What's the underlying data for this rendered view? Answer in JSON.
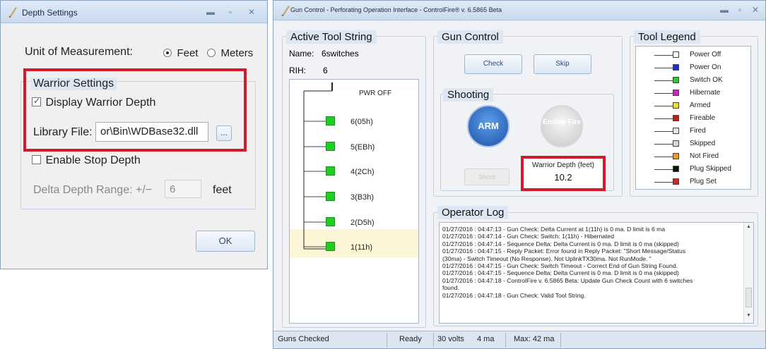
{
  "depth_settings": {
    "title": "Depth Settings",
    "unit_label": "Unit of Measurement:",
    "unit_options": [
      "Feet",
      "Meters"
    ],
    "unit_selected": "Feet",
    "warrior_group_title": "Warrior Settings",
    "display_warrior_depth_label": "Display Warrior Depth",
    "display_warrior_depth_checked": true,
    "library_file_label": "Library File:",
    "library_file_value": "or\\Bin\\WDBase32.dll",
    "browse_label": "...",
    "enable_stop_depth_label": "Enable Stop Depth",
    "enable_stop_depth_checked": false,
    "delta_depth_label": "Delta Depth Range: +/−",
    "delta_depth_value": "6",
    "delta_depth_unit": "feet",
    "ok_label": "OK",
    "highlight_color": "#d3192a"
  },
  "gun_control": {
    "title": "Gun Control - Perforating Operation Interface - ControlFire® v. 6.5865 Beta",
    "active_tool_string": {
      "title": "Active Tool String",
      "name_label": "Name:",
      "name_value": "6switches",
      "rih_label": "RIH:",
      "rih_value": "6",
      "pwr_label": "PWR OFF",
      "switches": [
        "6(05h)",
        "5(EBh)",
        "4(2Ch)",
        "3(B3h)",
        "2(D5h)",
        "1(11h)"
      ],
      "selected_switch": "1(11h)"
    },
    "gun_control_panel": {
      "title": "Gun Control",
      "check_label": "Check",
      "skip_label": "Skip",
      "shooting_title": "Shooting",
      "arm_label": "ARM",
      "enable_fire_label": "Enable Fire",
      "shoot_label": "Shoot",
      "warrior_depth_label": "Warrior Depth (feet)",
      "warrior_depth_value": "10.2"
    },
    "tool_legend": {
      "title": "Tool Legend",
      "items": [
        {
          "label": "Power Off",
          "color": "#ffffff"
        },
        {
          "label": "Power On",
          "color": "#1a2ee0"
        },
        {
          "label": "Switch OK",
          "color": "#22d022"
        },
        {
          "label": "Hibernate",
          "color": "#d020d0"
        },
        {
          "label": "Armed",
          "color": "#f0e020"
        },
        {
          "label": "Fireable",
          "color": "#d01818"
        },
        {
          "label": "Fired",
          "color": "#e8e8e8"
        },
        {
          "label": "Skipped",
          "color": "#d8d8d8"
        },
        {
          "label": "Not Fired",
          "color": "#f09a20"
        },
        {
          "label": "Plug Skipped",
          "color": "#111111"
        },
        {
          "label": "Plug Set",
          "color": "#e02020"
        }
      ]
    },
    "operator_log": {
      "title": "Operator Log",
      "lines": [
        "01/27/2016 : 04:47:13 - Gun Check: Delta Current at 1(11h) is 0 ma. D limit is 6 ma",
        "01/27/2016 : 04:47:14 - Gun Check: Switch: 1(11h) - Hibernated",
        "01/27/2016 : 04:47:14 - Sequence Delta: Delta Current is 0 ma. D limit is 0 ma (skipped)",
        "01/27/2016 : 04:47:15 - Reply Packet: Error found in Reply Packet: \"Short Message/Status",
        "(30ma) - Switch Timeout (No Response). Not UplinkTX30ma. Not RunMode. \"",
        "01/27/2016 : 04:47:15 - Gun Check: Switch Timeout - Correct End of Gun String Found.",
        "01/27/2016 : 04:47:15 - Sequence Delta: Delta Current is 0 ma. D limit is 0 ma (skipped)",
        "01/27/2016 : 04:47:18 - ControlFire v. 6.5865 Beta: Update Gun Check Count with 6 switches",
        "found.",
        "01/27/2016 : 04:47:18 - Gun Check: Valid Tool String."
      ]
    },
    "status_bar": {
      "status": "Guns Checked",
      "ready": "Ready",
      "volts": "30 volts",
      "current": "4 ma",
      "max": "Max: 42 ma"
    }
  }
}
